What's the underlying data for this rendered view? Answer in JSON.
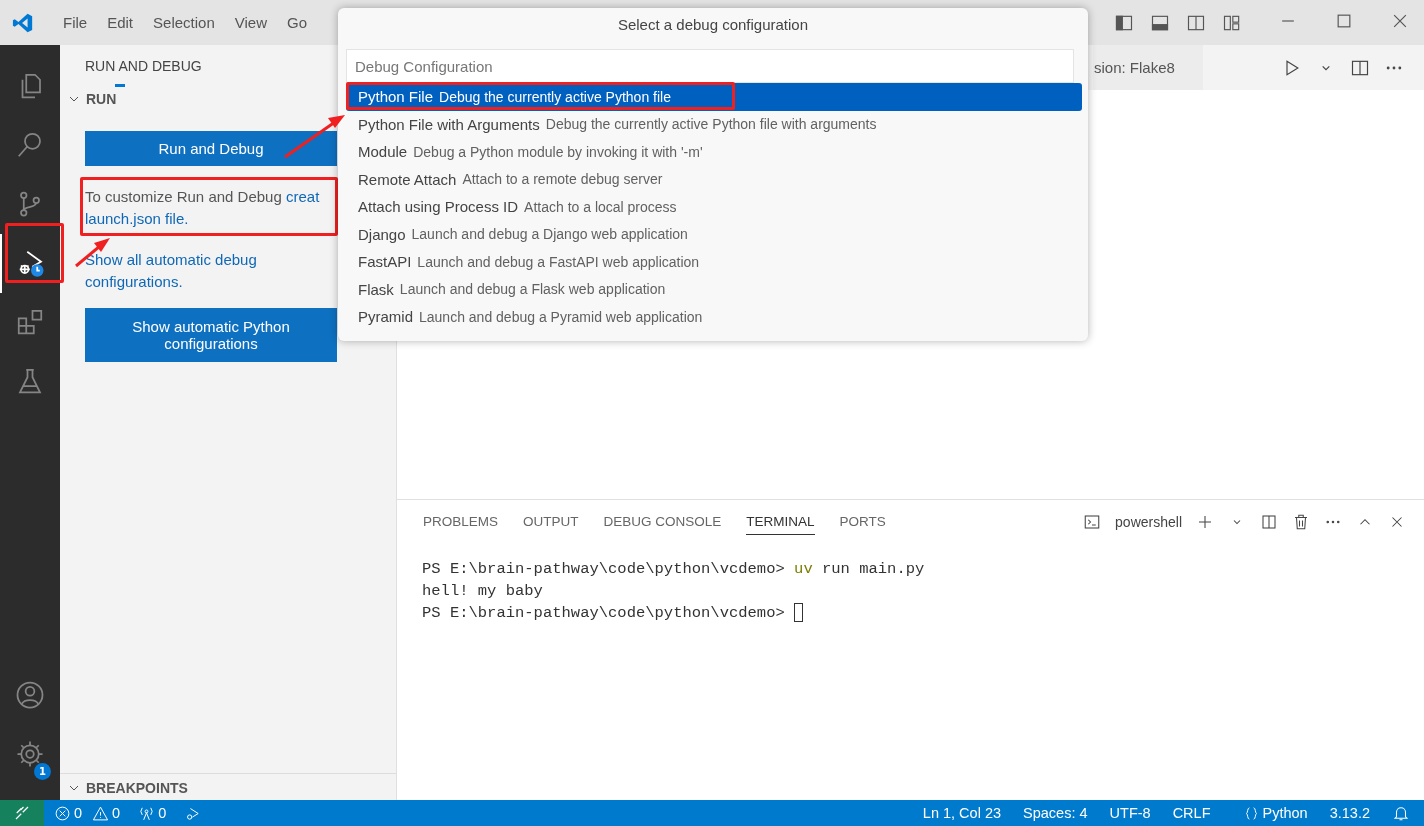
{
  "title_bar": {
    "menu": [
      "File",
      "Edit",
      "Selection",
      "View",
      "Go"
    ]
  },
  "activity_bar": {
    "items": [
      {
        "kind": "files",
        "selected": false
      },
      {
        "kind": "search",
        "selected": false
      },
      {
        "kind": "source-control",
        "selected": false
      },
      {
        "kind": "run-debug",
        "selected": true
      },
      {
        "kind": "extensions",
        "selected": false
      },
      {
        "kind": "testing",
        "selected": false
      }
    ],
    "settings_badge": "1"
  },
  "sidebar": {
    "title": "RUN AND DEBUG",
    "section": "RUN",
    "run_button": "Run and Debug",
    "customize_text": "To customize Run and Debug ",
    "customize_link": "creat",
    "customize_link_2": "launch.json file.",
    "show_all_link": "Show all automatic debug configurations.",
    "python_button": "Show automatic Python configurations",
    "breakpoints": "BREAKPOINTS"
  },
  "editor": {
    "tab": "sion: Flake8"
  },
  "quick_pick": {
    "title": "Select a debug configuration",
    "placeholder": "Debug Configuration",
    "items": [
      {
        "label": "Python File",
        "description": "Debug the currently active Python file",
        "selected": true
      },
      {
        "label": "Python File with Arguments",
        "description": "Debug the currently active Python file with arguments",
        "selected": false
      },
      {
        "label": "Module",
        "description": "Debug a Python module by invoking it with '-m'",
        "selected": false
      },
      {
        "label": "Remote Attach",
        "description": "Attach to a remote debug server",
        "selected": false
      },
      {
        "label": "Attach using Process ID",
        "description": "Attach to a local process",
        "selected": false
      },
      {
        "label": "Django",
        "description": "Launch and debug a Django web application",
        "selected": false
      },
      {
        "label": "FastAPI",
        "description": "Launch and debug a FastAPI web application",
        "selected": false
      },
      {
        "label": "Flask",
        "description": "Launch and debug a Flask web application",
        "selected": false
      },
      {
        "label": "Pyramid",
        "description": "Launch and debug a Pyramid web application",
        "selected": false
      }
    ]
  },
  "panel": {
    "tabs": [
      {
        "label": "PROBLEMS",
        "selected": false
      },
      {
        "label": "OUTPUT",
        "selected": false
      },
      {
        "label": "DEBUG CONSOLE",
        "selected": false
      },
      {
        "label": "TERMINAL",
        "selected": true
      },
      {
        "label": "PORTS",
        "selected": false
      }
    ],
    "terminal_profile": "powershell",
    "lines": [
      {
        "kind": "command",
        "prompt": "PS E:\\brain-pathway\\code\\python\\vcdemo>",
        "program": "uv",
        "args": "run main.py"
      },
      {
        "kind": "output",
        "text": "hell! my baby"
      },
      {
        "kind": "cursor",
        "prompt": "PS E:\\brain-pathway\\code\\python\\vcdemo>"
      }
    ]
  },
  "status_bar": {
    "errors": "0",
    "warnings": "0",
    "ports": "0",
    "right": [
      "Ln 1, Col 23",
      "Spaces: 4",
      "UTF-8",
      "CRLF"
    ],
    "language": "Python",
    "version": "3.13.2"
  }
}
